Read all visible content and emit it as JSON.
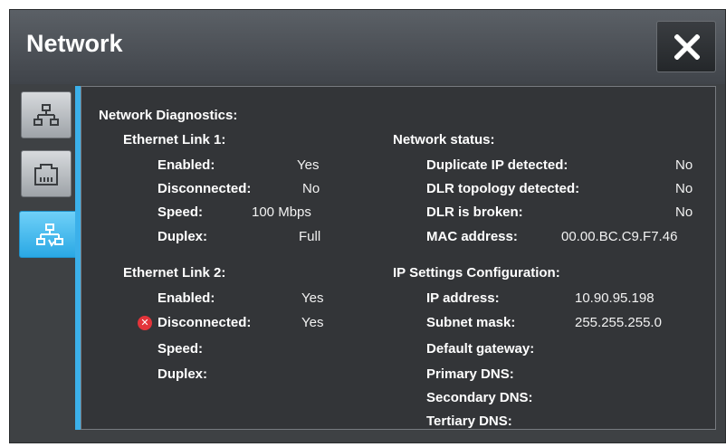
{
  "window": {
    "title": "Network"
  },
  "buttons": {
    "close_icon": "close-x-icon"
  },
  "tabs": [
    {
      "icon": "network-topology-icon",
      "active": false
    },
    {
      "icon": "ethernet-port-icon",
      "active": false
    },
    {
      "icon": "network-diagnostics-icon",
      "active": true
    }
  ],
  "content": {
    "section_title": "Network Diagnostics:",
    "link1": {
      "title": "Ethernet Link 1:",
      "enabled": {
        "label": "Enabled:",
        "value": "Yes"
      },
      "disconnected": {
        "label": "Disconnected:",
        "value": "No"
      },
      "speed": {
        "label": "Speed:",
        "value": "100 Mbps"
      },
      "duplex": {
        "label": "Duplex:",
        "value": "Full"
      }
    },
    "link2": {
      "title": "Ethernet Link 2:",
      "enabled": {
        "label": "Enabled:",
        "value": "Yes"
      },
      "disconnected": {
        "label": "Disconnected:",
        "value": "Yes",
        "status": "error"
      },
      "speed": {
        "label": "Speed:",
        "value": ""
      },
      "duplex": {
        "label": "Duplex:",
        "value": ""
      }
    },
    "network_status": {
      "title": "Network status:",
      "duplicate_ip": {
        "label": "Duplicate IP detected:",
        "value": "No"
      },
      "dlr_topology": {
        "label": "DLR topology detected:",
        "value": "No"
      },
      "dlr_broken": {
        "label": "DLR is broken:",
        "value": "No"
      },
      "mac": {
        "label": "MAC address:",
        "value": "00.00.BC.C9.F7.46"
      }
    },
    "ip_settings": {
      "title": "IP Settings Configuration:",
      "ip": {
        "label": "IP address:",
        "value": "10.90.95.198"
      },
      "subnet": {
        "label": "Subnet mask:",
        "value": "255.255.255.0"
      },
      "gateway": {
        "label": "Default gateway:",
        "value": ""
      },
      "primary_dns": {
        "label": "Primary DNS:",
        "value": ""
      },
      "secondary_dns": {
        "label": "Secondary DNS:",
        "value": ""
      },
      "tertiary_dns": {
        "label": "Tertiary DNS:",
        "value": ""
      }
    }
  },
  "colors": {
    "accent": "#3bb0ea",
    "panel_bg": "#333538",
    "error": "#e3343a"
  }
}
